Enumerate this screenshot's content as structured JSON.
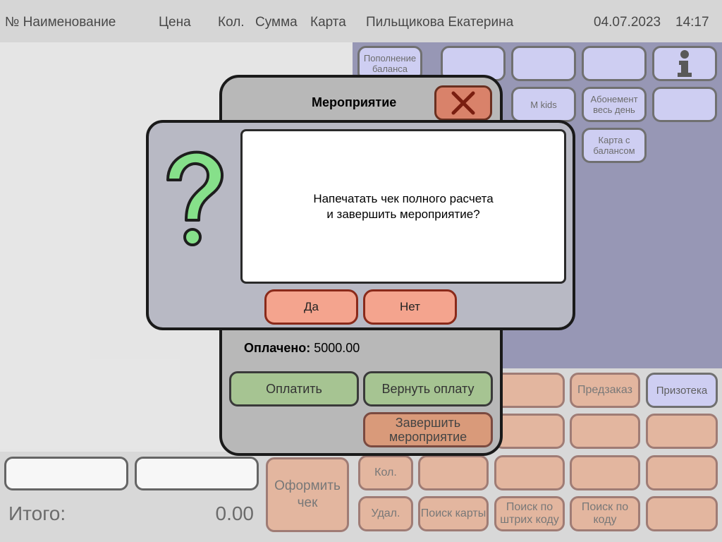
{
  "header": {
    "col_name": "№ Наименование",
    "col_price": "Цена",
    "col_qty": "Кол.",
    "col_sum": "Сумма",
    "col_card": "Карта",
    "user": "Пильщикова Екатерина",
    "date": "04.07.2023",
    "time": "14:17"
  },
  "grid": {
    "topup": "Пополнение баланса",
    "info_icon": "info-icon",
    "mkids": "M kids",
    "abonement": "Абонемент весь день",
    "card_balance": "Карта с балансом"
  },
  "actions": {
    "preorder": "Предзаказ",
    "prizoteka": "Призотека",
    "checkout": "Оформить чек",
    "qty": "Кол.",
    "delete": "Удал.",
    "search_card": "Поиск карты",
    "search_barcode": "Поиск по штрих коду",
    "search_code": "Поиск по коду"
  },
  "totals": {
    "label": "Итого:",
    "value": "0.00"
  },
  "event_panel": {
    "title": "Мероприятие",
    "paid_label": "Оплачено:",
    "paid_value": "5000.00",
    "pay_button": "Оплатить",
    "refund_button": "Вернуть оплату",
    "finish_button": "Завершить мероприятие"
  },
  "dialog": {
    "line1": "Напечатать чек полного расчета",
    "line2": "и завершить мероприятие?",
    "yes": "Да",
    "no": "Нет",
    "icon": "question-icon"
  },
  "colors": {
    "grid_bg": "#6f6f99",
    "purple_button": "#bcbcee",
    "orange_button": "#d99a7a",
    "green_button": "#a6c492",
    "dialog_button": "#f4a48e",
    "question_green": "#86e08a"
  }
}
